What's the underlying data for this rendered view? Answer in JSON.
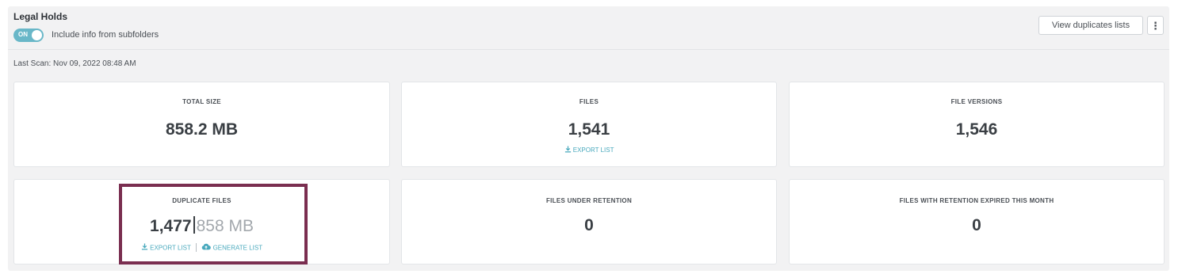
{
  "header": {
    "title": "Legal Holds",
    "toggle_state": "ON",
    "toggle_label": "Include info from subfolders",
    "view_duplicates_label": "View duplicates lists",
    "more_menu_glyph": "⋮"
  },
  "last_scan": "Last Scan: Nov 09, 2022 08:48 AM",
  "cards": {
    "total_size": {
      "label": "TOTAL SIZE",
      "value": "858.2 MB"
    },
    "files": {
      "label": "FILES",
      "value": "1,541",
      "action": "EXPORT LIST"
    },
    "file_versions": {
      "label": "FILE VERSIONS",
      "value": "1,546"
    },
    "duplicate_files": {
      "label": "DUPLICATE FILES",
      "count": "1,477",
      "size": "858 MB",
      "export_action": "EXPORT LIST",
      "generate_action": "GENERATE LIST"
    },
    "files_under_retention": {
      "label": "FILES UNDER RETENTION",
      "value": "0"
    },
    "retention_expired": {
      "label": "FILES WITH RETENTION EXPIRED THIS MONTH",
      "value": "0"
    }
  },
  "icons": {
    "download": "download-icon",
    "cloud_upload": "cloud-upload-icon",
    "more": "more-vertical-icon"
  },
  "colors": {
    "accent": "#49a9bd",
    "toggle_on": "#69b7c8",
    "highlight_border": "#7a2e50"
  }
}
